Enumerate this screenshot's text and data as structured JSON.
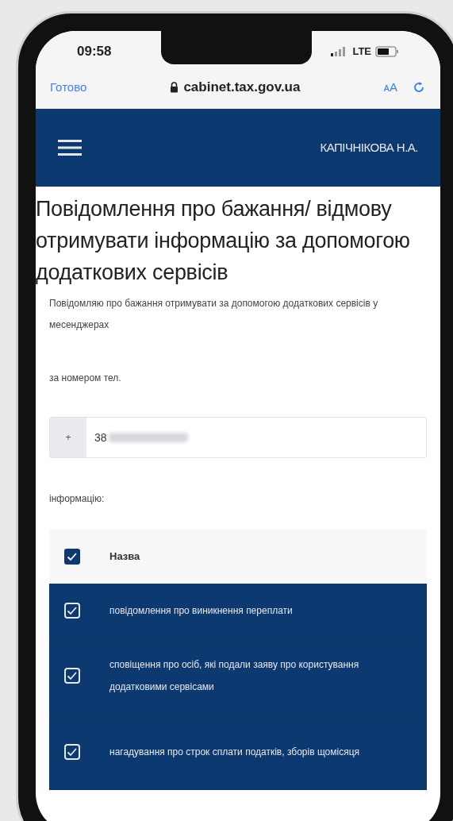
{
  "status_bar": {
    "time": "09:58",
    "network": "LTE"
  },
  "browser": {
    "done_label": "Готово",
    "url": "cabinet.tax.gov.ua",
    "text_size_label": "ᴀA"
  },
  "header": {
    "user_name": "КАПІЧНІКОВА Н.А."
  },
  "page": {
    "title": "Повідомлення про бажання/ відмову отримувати інформацію за допомогою додаткових сервісів",
    "intro": "Повідомляю про бажання отримувати за допомогою додаткових сервісів у месенджерах",
    "phone_label": "за номером тел.",
    "phone_field": {
      "prefix": "+",
      "value": "38"
    },
    "info_label": "інформацію:"
  },
  "table": {
    "header": {
      "label": "Назва",
      "checked": true
    },
    "rows": [
      {
        "label": "повідомлення про виникнення переплати",
        "checked": true,
        "selected": true
      },
      {
        "label": "сповіщення про осіб, які подали заяву про користування додатковими сервісами",
        "checked": true,
        "selected": true
      },
      {
        "label": "нагадування про строк сплати податків, зборів щомісяця",
        "checked": true,
        "selected": true
      }
    ]
  }
}
